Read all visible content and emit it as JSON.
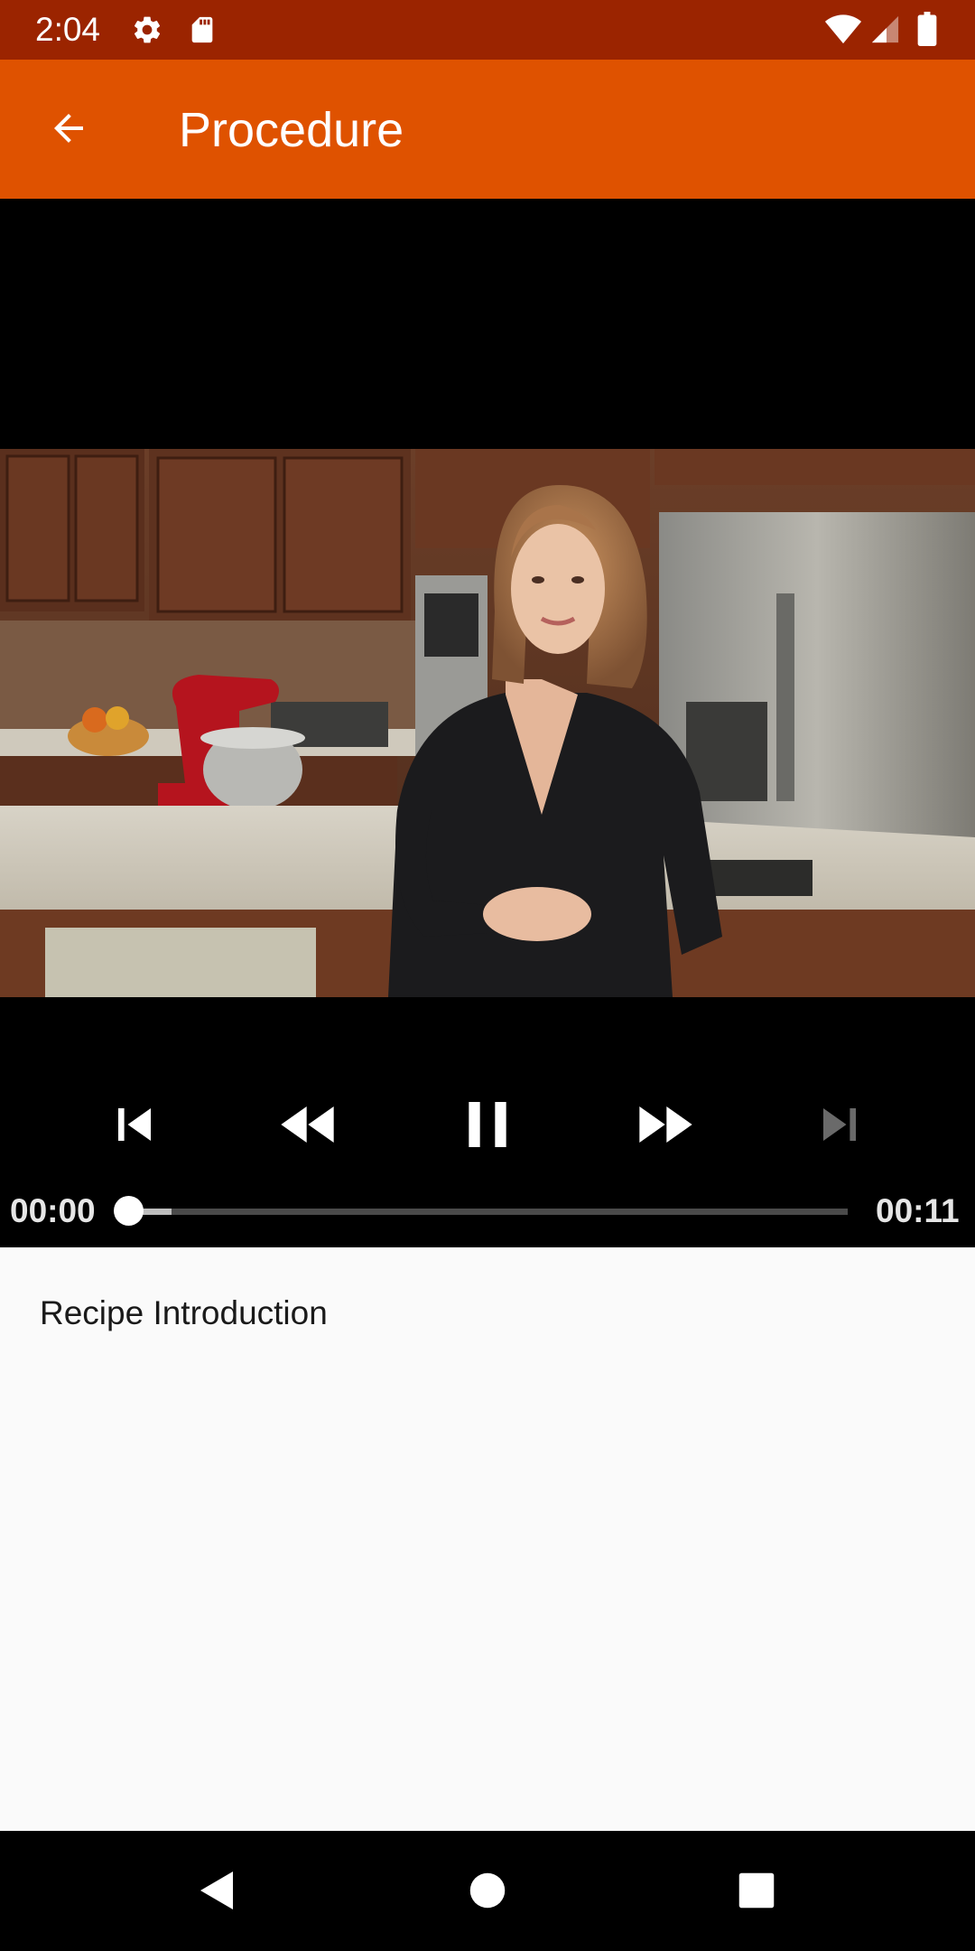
{
  "status_bar": {
    "time": "2:04",
    "icons": [
      "settings-icon",
      "sd-card-icon",
      "wifi-icon",
      "cellular-signal-icon",
      "battery-icon"
    ],
    "background": "#9b2400"
  },
  "app_bar": {
    "title": "Procedure",
    "back_icon": "arrow-back-icon",
    "background": "#df5200"
  },
  "player": {
    "controls": [
      "skip-previous-icon",
      "rewind-icon",
      "pause-icon",
      "fast-forward-icon",
      "skip-next-icon"
    ],
    "skip_next_enabled": false,
    "position": "00:00",
    "duration": "00:11",
    "played_fraction": 0.0,
    "buffered_fraction": 0.06
  },
  "content": {
    "step_description": "Recipe Introduction"
  },
  "nav_bar": {
    "buttons": [
      "nav-back-icon",
      "nav-home-icon",
      "nav-recents-icon"
    ]
  }
}
